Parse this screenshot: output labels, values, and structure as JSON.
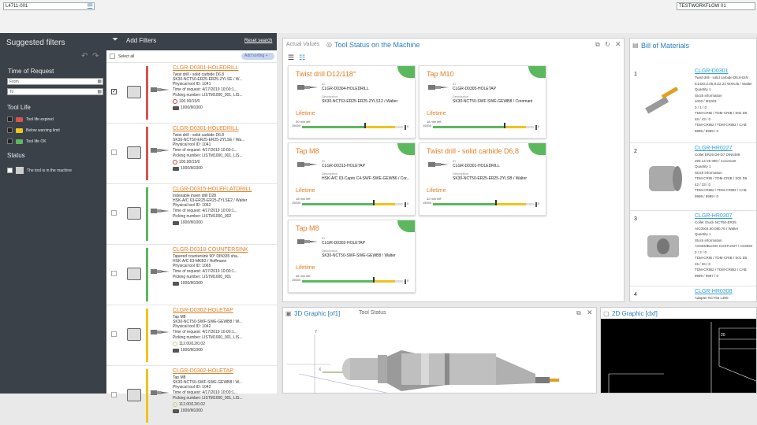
{
  "topbar": {
    "search_value": "L4711-001",
    "workflow": "TESTWORKFLOW 01"
  },
  "left": {
    "title": "Suggested filters",
    "time_label": "Time of Request",
    "from_placeholder": "From",
    "to_placeholder": "To",
    "toollife_label": "Tool Life",
    "toollife_items": [
      {
        "label": "Tool life expired",
        "color": "#d9534f"
      },
      {
        "label": "Below warning limit",
        "color": "#f0c419"
      },
      {
        "label": "Tool life OK",
        "color": "#5cb85c"
      }
    ],
    "status_label": "Status",
    "status_item": "The tool is in the machine"
  },
  "filters": {
    "title": "Add Filters",
    "reset": "Reset search",
    "select_all": "Select all",
    "add_sorting": "Add sorting +",
    "rows": [
      {
        "title": "CLGR-D0301-HOLEDRILL",
        "line1": "Twist drill - solid carbide D6.8",
        "line2": "SK30-NCT50-ER25-ER25-ZYLSE / W...",
        "line3": "Physical tool ID: 1041",
        "line4": "Time of request: 4/17/2019 10:00:1...",
        "line5": "Picking number: LISTM1000_001, LIS...",
        "life": "100.00/15/0",
        "count": "1000/M1000",
        "status": "expired",
        "checked": true
      },
      {
        "title": "CLGR-D0301-HOLEDRILL",
        "line1": "Twist drill - solid carbide D6.8",
        "line2": "SK30-NCT50-ER25-ER25-ZYLSE / Wa...",
        "line3": "Physical tool ID: 1041",
        "line4": "Time of request: 4/17/2019 10:00:1...",
        "line5": "Picking number: LISTM1000_001, LIS...",
        "life": "100.00/15/0",
        "count": "1000/M1000",
        "status": "expired",
        "checked": false
      },
      {
        "title": "CLGR-D0315-HOLEFLATDRILL",
        "line1": "Indexable insert drill D28",
        "line2": "HSK-A/C 63-ER25-ER25-ZYLSE2 / Walter",
        "line3": "Physical tool ID: 1062",
        "line4": "Time of request: 4/17/2019 10:00:1...",
        "line5": "Picking number: LISTM1000_002",
        "life": "",
        "count": "1000/M1000",
        "status": "ok",
        "checked": false
      },
      {
        "title": "CLGR-D0318-COUNTERSINK",
        "line1": "Tapered countersink 90° DIN335 sha...",
        "line2": "HSK-A/C 63-MKB3 / Hoffmann",
        "line3": "Physical tool ID: 1065",
        "line4": "Time of request: 4/17/2019 10:00:1...",
        "line5": "Picking number: LISTM1000_001",
        "life": "",
        "count": "1000/M1000",
        "status": "ok",
        "checked": false
      },
      {
        "title": "CLGR-D0302-HOLETAP",
        "line1": "Tap M8",
        "line2": "SK30-NCT50-SWF-SWE-GEWB8 / W...",
        "line3": "Physical tool ID: 1042",
        "line4": "Time of request: 4/17/2019 10:00:1...",
        "line5": "Picking number: LISTM1000_001, LIS...",
        "life": "112.00/12/0.02",
        "count": "1000/M1000",
        "status": "warn",
        "checked": false
      },
      {
        "title": "CLGR-D0302-HOLETAP",
        "line1": "Tap M8",
        "line2": "SK30-NCT50-SWF-SWE-GEWB8 / W...",
        "line3": "Physical tool ID: 1042",
        "line4": "Time of request: 4/17/2019 10:00:1...",
        "line5": "Picking number: LISTM1000_001, LIS...",
        "life": "112.00/12/0.02",
        "count": "1000/M1000",
        "status": "warn",
        "checked": false
      }
    ]
  },
  "toolstatus": {
    "head": "Actual Values",
    "title": "Tool Status on the Machine",
    "id_label": "ID",
    "desc_label": "Description",
    "life_label": "Lifetime",
    "gauge_min": "15000",
    "gauge_max": "0",
    "cards": [
      {
        "title": "Twist drill D12/118°",
        "id": "CLGR-D0304-HOLEDRILL",
        "desc": "SK30-NCT63-ER25-ER25-ZYLS12 / Walter",
        "mins": "30  min left",
        "fill": 0.62
      },
      {
        "title": "Tap M10",
        "id": "CLGR-D0305-HOLETAP",
        "desc": "SK30-NCT50-SWF-SWE-GEWB8 / Coromant",
        "mins": "18  min left",
        "fill": 0.7
      },
      {
        "title": "Tap M8",
        "id": "CLGR-D0313-HOLETAP",
        "desc": "HSK-A/C 63-Capto C4-SWF-SWE-GEWB6 / Cor...",
        "mins": "18  min left",
        "fill": 0.7
      },
      {
        "title": "Twist drill - solid carbide D6,8",
        "id": "CLGR-D0301-HOLEDRILL",
        "desc": "SK30-NCT50-ER25-ER25-ZYLSB / Walter",
        "mins": "32  min left",
        "fill": 0.62
      },
      {
        "title": "Tap M8",
        "id": "CLGR-D0302-HOLETAP",
        "desc": "SK30-NCT50-SWF-SWE-GEWB8 / Walter",
        "mins": "48  min left",
        "fill": 0.7
      }
    ]
  },
  "bom": {
    "title": "Bill of Materials",
    "items": [
      {
        "num": "1",
        "id": "CLGR-D0301",
        "lines": [
          "Twist drill - solid carbide D6.8-DIN",
          "E1420.Z.06,8.Z2.24 WXK35 / Walter",
          "Quantity   1",
          "Stock information",
          "1003 / M1003",
          "0 / 1 / 0",
          "TDM-CRIB / TDM-CRIB / S02 D5",
          "48 / 43 / 0",
          "TDM-CRIB2 / TDM-CRIB2 / CAB",
          "9999 / 9999 / 0"
        ]
      },
      {
        "num": "2",
        "id": "CLGR-HR0227",
        "lines": [
          "Collet ER25 D8-D7 DIN6499",
          "393.14-25 080 / Coromant",
          "Quantity   1",
          "Stock information",
          "TDM-CRIB / TDM-CRIB / S02 D5",
          "42 / 33 / 0",
          "TDM-CRIB2 / TDM-CRIB2 / CAB",
          "9999 / 9999 / 0"
        ]
      },
      {
        "num": "3",
        "id": "CLGR-HR0307",
        "lines": [
          "Collet chuck NCT50-ER25",
          "AIC0004.50.080.76 / Walter",
          "Quantity   1",
          "Stock information",
          "ASSEMBLING-COSTUNIT / ASSEM",
          "0 / 2 / 0",
          "TDM-CRIB / TDM-CRIB / S01 D5",
          "15 / 26 / 0",
          "TDM-CRIB2 / TDM-CRIB2 / CAB",
          "9999 / 9997 / 0"
        ]
      },
      {
        "num": "4",
        "id": "CLGR-HR0308",
        "lines": [
          "Adapter NCT50 L300"
        ]
      }
    ]
  },
  "graphic3d": {
    "title": "3D Graphic [of1]",
    "sub": "Tool Status",
    "axis_x": "X",
    "axis_y": "Y"
  },
  "graphic2d": {
    "title": "2D Graphic [dxf]",
    "label20": "20"
  }
}
